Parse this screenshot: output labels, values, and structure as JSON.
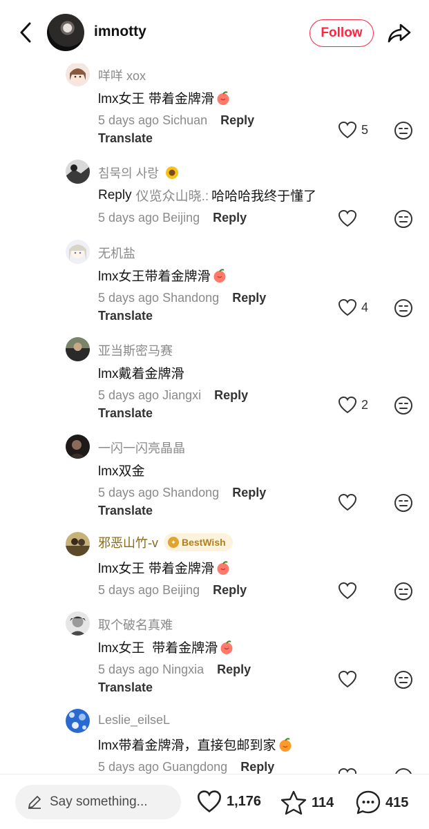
{
  "header": {
    "username": "imnotty",
    "follow_label": "Follow"
  },
  "comments": [
    {
      "name": "咩咩 xox",
      "text": "lmx女王 带着金牌滑",
      "emoji": "peach",
      "time": "5 days ago",
      "location": "Sichuan",
      "reply": "Reply",
      "translate": "Translate",
      "likes": "5",
      "avatar": "anime-girl"
    },
    {
      "name": "침묵의 사랑",
      "name_emoji": "sunflower",
      "text": "哈哈哈我终于懂了",
      "reply_prefix": "Reply",
      "reply_to": "仪览众山晓.:",
      "time": "5 days ago",
      "location": "Beijing",
      "reply": "Reply",
      "likes": "",
      "avatar": "dark-photo"
    },
    {
      "name": "无机盐",
      "text": "lmx女王带着金牌滑",
      "emoji": "peach",
      "time": "5 days ago",
      "location": "Shandong",
      "reply": "Reply",
      "translate": "Translate",
      "likes": "4",
      "avatar": "anime-light"
    },
    {
      "name": "亚当斯密马赛",
      "text": "lmx戴着金牌滑",
      "time": "5 days ago",
      "location": "Jiangxi",
      "reply": "Reply",
      "translate": "Translate",
      "likes": "2",
      "avatar": "person-dark"
    },
    {
      "name": "一闪一闪亮晶晶",
      "text": "lmx双金",
      "time": "5 days ago",
      "location": "Shandong",
      "reply": "Reply",
      "translate": "Translate",
      "likes": "",
      "avatar": "portrait-dark"
    },
    {
      "name": "邪恶山竹-v",
      "badge": "BestWish",
      "text": "lmx女王 带着金牌滑",
      "emoji": "peach",
      "time": "5 days ago",
      "location": "Beijing",
      "reply": "Reply",
      "likes": "",
      "avatar": "outdoor"
    },
    {
      "name": "取个破名真难",
      "text": "lmx女王  带着金牌滑",
      "emoji": "peach",
      "time": "5 days ago",
      "location": "Ningxia",
      "reply": "Reply",
      "translate": "Translate",
      "likes": "",
      "avatar": "portrait-bw"
    },
    {
      "name": "Leslie_eilseL",
      "text": "lmx带着金牌滑，直接包邮到家",
      "emoji": "orange",
      "time": "5 days ago",
      "location": "Guangdong",
      "reply": "Reply",
      "likes": "",
      "avatar": "blue-pattern"
    }
  ],
  "bottom": {
    "say_placeholder": "Say something...",
    "likes": "1,176",
    "stars": "114",
    "comments": "415"
  },
  "colors": {
    "accent": "#ff2442",
    "muted": "#8a8a8a"
  }
}
